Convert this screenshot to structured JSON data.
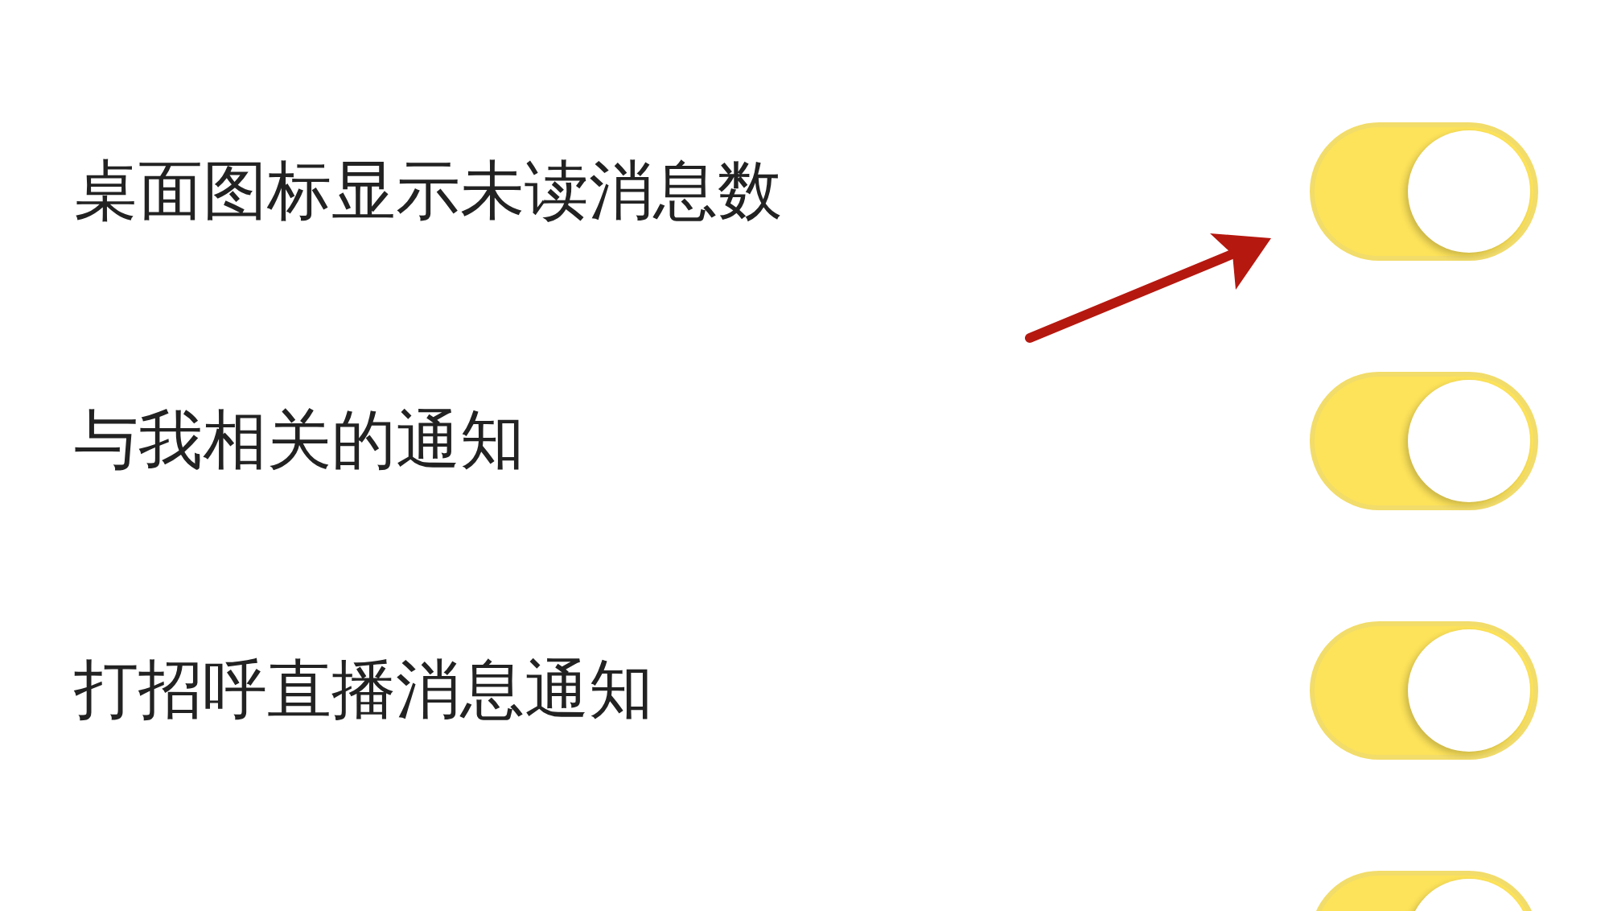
{
  "settings": [
    {
      "label": "桌面图标显示未读消息数",
      "on": true
    },
    {
      "label": "与我相关的通知",
      "on": true
    },
    {
      "label": "打招呼直播消息通知",
      "on": true
    },
    {
      "on": true
    }
  ],
  "annotation": {
    "kind": "arrow"
  }
}
